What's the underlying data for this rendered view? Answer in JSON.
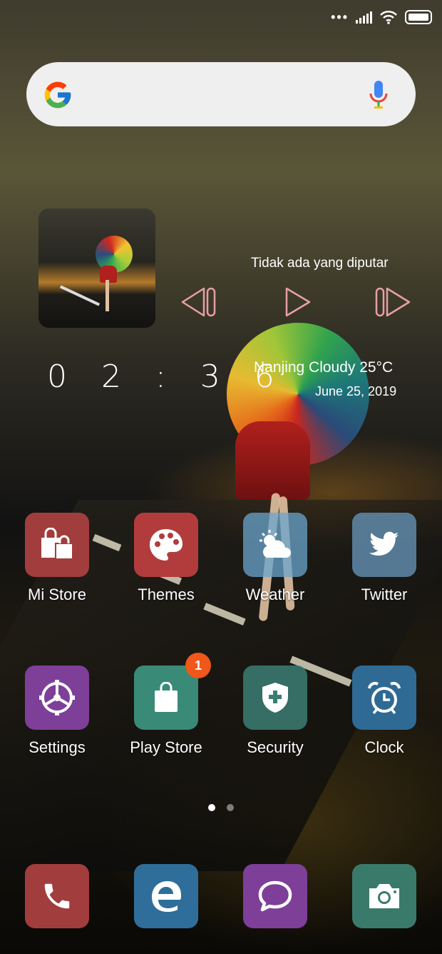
{
  "status_bar": {
    "icons": [
      "more-dots-icon",
      "signal-icon",
      "wifi-icon",
      "battery-icon"
    ]
  },
  "search": {
    "logo": "google-g-icon",
    "mic": "mic-icon"
  },
  "music": {
    "now_playing": "Tidak ada yang diputar",
    "controls": [
      "previous-icon",
      "play-icon",
      "next-icon"
    ]
  },
  "clock": {
    "time": "0 2 : 3 6"
  },
  "weather": {
    "summary": "Nanjing  Cloudy  25°C",
    "date": "June  25, 2019"
  },
  "apps_row1": [
    {
      "label": "Mi Store",
      "icon": "shopping-bags-icon",
      "color": "#a23d3d"
    },
    {
      "label": "Themes",
      "icon": "palette-icon",
      "color": "#b23c3c"
    },
    {
      "label": "Weather",
      "icon": "weather-icon",
      "color": "#5b9bc0"
    },
    {
      "label": "Twitter",
      "icon": "twitter-bird-icon",
      "color": "#5f8fb0"
    }
  ],
  "apps_row2": [
    {
      "label": "Settings",
      "icon": "gear-icon",
      "color": "#7e3f98"
    },
    {
      "label": "Play Store",
      "icon": "shopping-bag-icon",
      "color": "#3a8a78",
      "badge": "1"
    },
    {
      "label": "Security",
      "icon": "shield-plus-icon",
      "color": "#3a7a72"
    },
    {
      "label": "Clock",
      "icon": "alarm-clock-icon",
      "color": "#2f6a95"
    }
  ],
  "pager": {
    "pages": 2,
    "active": 1
  },
  "dock": [
    {
      "name": "phone",
      "icon": "phone-icon",
      "color": "#a23d3d"
    },
    {
      "name": "browser",
      "icon": "edge-browser-icon",
      "color": "#2f6e9a"
    },
    {
      "name": "messaging",
      "icon": "chat-bubble-icon",
      "color": "#7e3f98"
    },
    {
      "name": "camera",
      "icon": "camera-icon",
      "color": "#3a7a6a"
    }
  ]
}
